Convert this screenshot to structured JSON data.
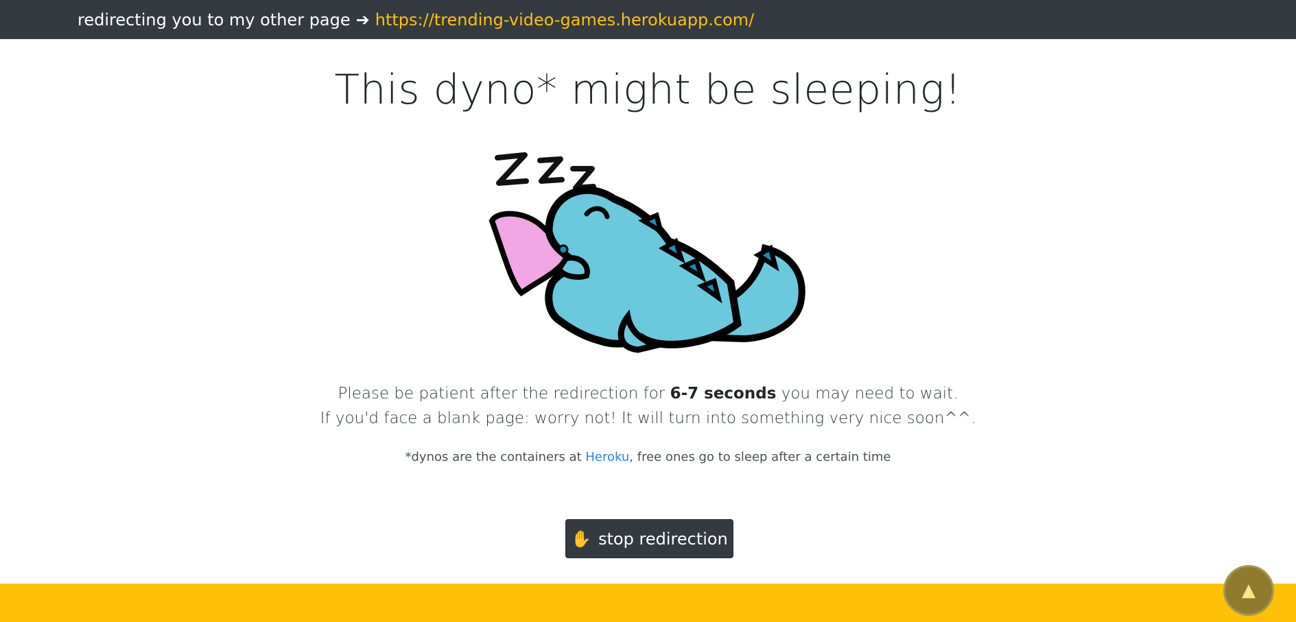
{
  "topbar": {
    "text": "redirecting you to my other page",
    "arrow": "➔",
    "link": "https://trending-video-games.herokuapp.com/"
  },
  "main": {
    "title": "This dyno* might be sleeping!",
    "image_alt": "sleeping dinosaur",
    "zzz": "Z Z Z",
    "para1_before": "Please be patient after the redirection for ",
    "para1_bold": "6-7 seconds",
    "para1_after": " you may need to wait.",
    "para2": "If you'd face a blank page: worry not! It will turn into something very nice soon^^.",
    "note_before": "*dynos are the containers at ",
    "note_link": "Heroku",
    "note_after": ", free ones go to sleep after a certain time"
  },
  "button": {
    "icon": "✋",
    "label": "stop redirection"
  },
  "scroll_top": {
    "icon": "▲"
  },
  "colors": {
    "topbar": "#343a40",
    "accent": "#ffc107",
    "link": "#2f80ed"
  }
}
